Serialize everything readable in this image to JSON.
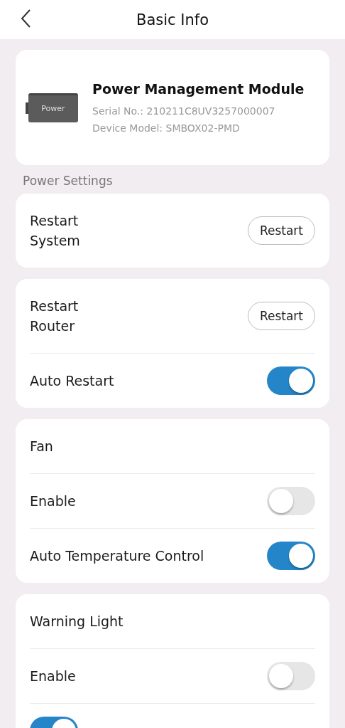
{
  "header": {
    "title": "Basic Info"
  },
  "device": {
    "image_label": "Power",
    "name": "Power Management Module",
    "serial": "Serial No.: 210211C8UV3257000007",
    "model": "Device Model: SMBOX02-PMD"
  },
  "section_label": "Power Settings",
  "cards": [
    {
      "rows": [
        {
          "kind": "button",
          "label": "Restart System",
          "button": "Restart"
        }
      ]
    },
    {
      "rows": [
        {
          "kind": "button",
          "label": "Restart Router",
          "button": "Restart"
        },
        {
          "kind": "toggle",
          "label": "Auto Restart",
          "on": true
        }
      ]
    },
    {
      "rows": [
        {
          "kind": "title",
          "label": "Fan"
        },
        {
          "kind": "toggle",
          "label": "Enable",
          "on": false
        },
        {
          "kind": "toggle",
          "label": "Auto Temperature Control",
          "on": true
        }
      ]
    },
    {
      "rows": [
        {
          "kind": "title",
          "label": "Warning Light"
        },
        {
          "kind": "toggle",
          "label": "Enable",
          "on": false
        },
        {
          "kind": "toggle",
          "on": true
        }
      ]
    }
  ]
}
